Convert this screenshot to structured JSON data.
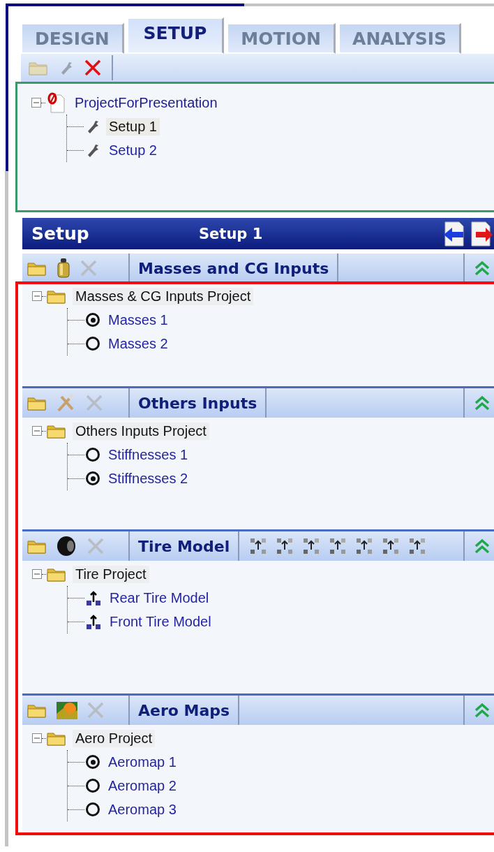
{
  "tabs": [
    {
      "label": "DESIGN",
      "selected": false
    },
    {
      "label": "SETUP",
      "selected": true
    },
    {
      "label": "MOTION",
      "selected": false
    },
    {
      "label": "ANALYSIS",
      "selected": false
    }
  ],
  "toolbar": [
    {
      "kind": "folder",
      "disabled": true
    },
    {
      "kind": "wrench",
      "disabled": true
    },
    {
      "kind": "delete",
      "disabled": false
    }
  ],
  "project_tree": {
    "label": "ProjectForPresentation",
    "expanded": true,
    "children": [
      {
        "label": "Setup 1",
        "selected": true
      },
      {
        "label": "Setup 2",
        "selected": false
      }
    ]
  },
  "setup_header": {
    "title": "Setup",
    "subtitle": "Setup 1"
  },
  "sections": [
    {
      "title": "Masses and CG Inputs",
      "tree": {
        "label": "Masses & CG Inputs Project",
        "expanded": true,
        "children": [
          {
            "label": "Masses 1",
            "kind": "radio",
            "checked": true
          },
          {
            "label": "Masses 2",
            "kind": "radio",
            "checked": false
          }
        ]
      }
    },
    {
      "title": "Others Inputs",
      "tree": {
        "label": "Others Inputs Project",
        "expanded": true,
        "children": [
          {
            "label": "Stiffnesses 1",
            "kind": "radio",
            "checked": false
          },
          {
            "label": "Stiffnesses 2",
            "kind": "radio",
            "checked": true
          }
        ]
      }
    },
    {
      "title": "Tire Model",
      "tree": {
        "label": "Tire Project",
        "expanded": true,
        "children": [
          {
            "label": "Rear Tire Model",
            "kind": "model"
          },
          {
            "label": "Front Tire Model",
            "kind": "model"
          }
        ]
      }
    },
    {
      "title": "Aero Maps",
      "tree": {
        "label": "Aero Project",
        "expanded": true,
        "children": [
          {
            "label": "Aeromap 1",
            "kind": "radio",
            "checked": true
          },
          {
            "label": "Aeromap 2",
            "kind": "radio",
            "checked": false
          },
          {
            "label": "Aeromap 3",
            "kind": "radio",
            "checked": false
          }
        ]
      }
    }
  ]
}
